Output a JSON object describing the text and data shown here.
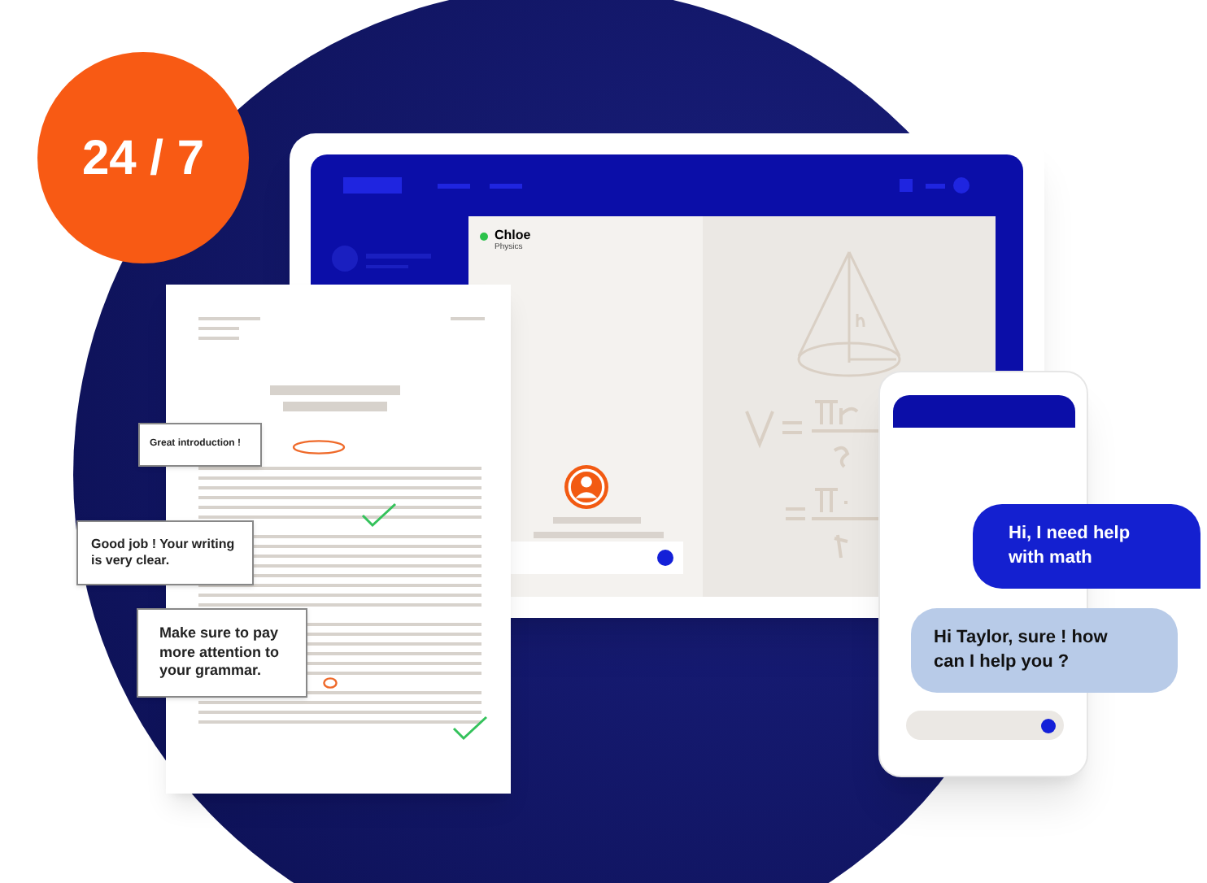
{
  "badge": {
    "text": "24 / 7"
  },
  "tablet": {
    "tutor": {
      "name": "Chloe",
      "subject": "Physics",
      "online": true
    }
  },
  "document": {
    "comments": [
      {
        "text": "Great introduction !"
      },
      {
        "text": "Good job ! Your writing is very clear."
      },
      {
        "text": "Make sure to pay more attention to your grammar."
      }
    ]
  },
  "phone": {
    "messages": [
      {
        "kind": "sent",
        "text": "Hi, I need help with math"
      },
      {
        "kind": "received",
        "text": "Hi Taylor, sure ! how can I help you ?"
      }
    ]
  }
}
